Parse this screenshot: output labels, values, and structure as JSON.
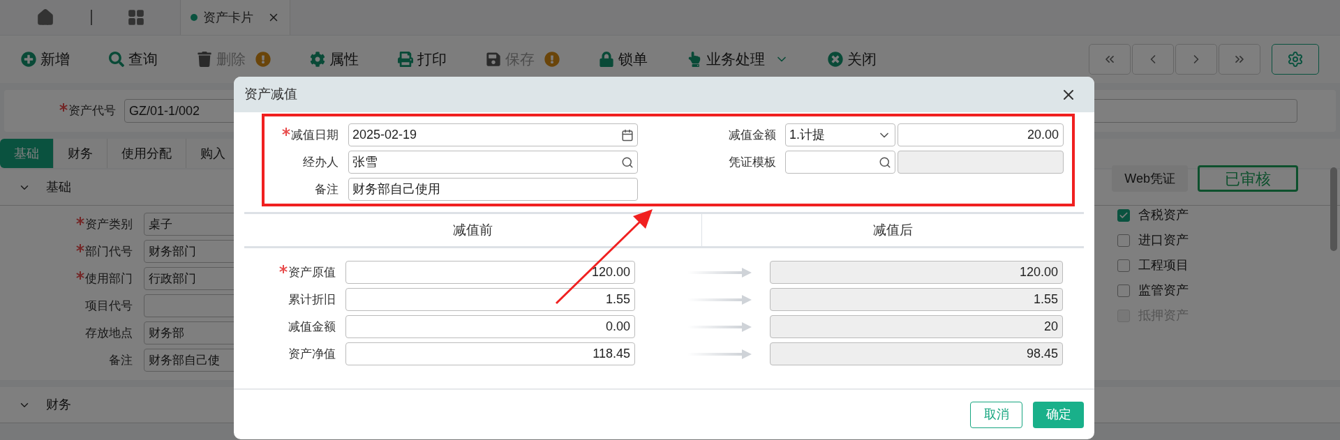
{
  "tabs": [
    {
      "label": "资产卡片",
      "selected": true
    }
  ],
  "toolbar": [
    {
      "label": "新增",
      "kind": "add",
      "disabled": false,
      "warning": false,
      "dropdown": false
    },
    {
      "label": "查询",
      "kind": "search",
      "disabled": false,
      "warning": false,
      "dropdown": false
    },
    {
      "label": "删除",
      "kind": "delete",
      "disabled": true,
      "warning": true,
      "dropdown": false
    },
    {
      "label": "属性",
      "kind": "settings",
      "disabled": false,
      "warning": false,
      "dropdown": false
    },
    {
      "label": "打印",
      "kind": "print",
      "disabled": false,
      "warning": false,
      "dropdown": false
    },
    {
      "label": "保存",
      "kind": "save",
      "disabled": true,
      "warning": true,
      "dropdown": false
    },
    {
      "label": "锁单",
      "kind": "lock",
      "disabled": false,
      "warning": false,
      "dropdown": false
    },
    {
      "label": "业务处理",
      "kind": "hand",
      "disabled": false,
      "warning": false,
      "dropdown": true
    },
    {
      "label": "关闭",
      "kind": "close",
      "disabled": false,
      "warning": false,
      "dropdown": false
    }
  ],
  "asset_code": {
    "label": "资产代号",
    "required": true,
    "value": "GZ/01-1/002"
  },
  "detail_tabs": [
    {
      "label": "基础",
      "selected": true
    },
    {
      "label": "财务",
      "selected": false
    },
    {
      "label": "使用分配",
      "selected": false
    },
    {
      "label": "购入",
      "selected": false
    }
  ],
  "sections": [
    {
      "title": "基础",
      "expanded": true
    },
    {
      "title": "财务",
      "expanded": true
    }
  ],
  "basic_fields": [
    {
      "label": "资产类别",
      "required": true,
      "value": "桌子"
    },
    {
      "label": "部门代号",
      "required": true,
      "value": "财务部门"
    },
    {
      "label": "使用部门",
      "required": true,
      "value": "行政部门"
    },
    {
      "label": "项目代号",
      "required": false
    },
    {
      "label": "存放地点",
      "required": false,
      "value": "财务部"
    },
    {
      "label": "备注",
      "required": false,
      "value": "财务部自己使"
    }
  ],
  "web_voucher": "Web凭证",
  "status_stamp": "已审核",
  "flags": [
    {
      "label": "含税资产",
      "checked": true,
      "disabled": false
    },
    {
      "label": "进口资产",
      "checked": false,
      "disabled": false
    },
    {
      "label": "工程项目",
      "checked": false,
      "disabled": false
    },
    {
      "label": "监管资产",
      "checked": false,
      "disabled": false
    },
    {
      "label": "抵押资产",
      "checked": false,
      "disabled": true
    }
  ],
  "dialog": {
    "title": "资产减值",
    "date": {
      "label": "减值日期",
      "required": true,
      "value": "2025-02-19"
    },
    "handler": {
      "label": "经办人",
      "required": false,
      "value": "张雪"
    },
    "remark": {
      "label": "备注",
      "required": false,
      "value": "财务部自己使用"
    },
    "amount": {
      "label": "减值金额",
      "type": "1.计提",
      "value": "20.00"
    },
    "voucher_template": {
      "label": "凭证模板"
    },
    "before_header": "减值前",
    "after_header": "减值后",
    "rows": [
      {
        "label": "资产原值",
        "required": true,
        "before": "120.00",
        "after": "120.00"
      },
      {
        "label": "累计折旧",
        "required": false,
        "before": "1.55",
        "after": "1.55"
      },
      {
        "label": "减值金额",
        "required": false,
        "before": "0.00",
        "after": "20"
      },
      {
        "label": "资产净值",
        "required": false,
        "before": "118.45",
        "after": "98.45"
      }
    ],
    "cancel": "取消",
    "ok": "确定"
  }
}
